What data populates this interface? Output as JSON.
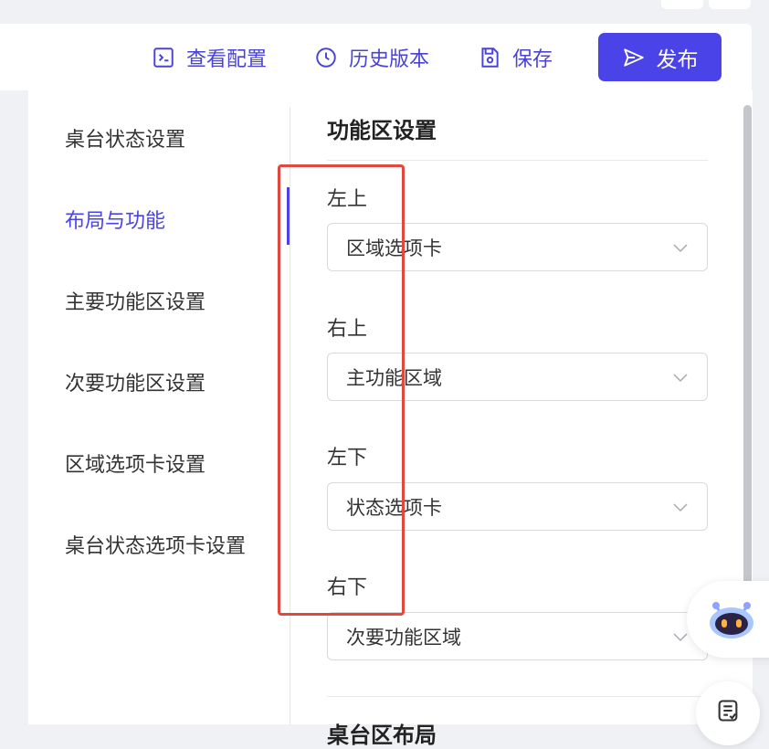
{
  "toolbar": {
    "view_config": "查看配置",
    "history": "历史版本",
    "save": "保存",
    "publish": "发布"
  },
  "nav": {
    "items": [
      {
        "label": "桌台状态设置",
        "active": false
      },
      {
        "label": "布局与功能",
        "active": true
      },
      {
        "label": "主要功能区设置",
        "active": false
      },
      {
        "label": "次要功能区设置",
        "active": false
      },
      {
        "label": "区域选项卡设置",
        "active": false
      },
      {
        "label": "桌台状态选项卡设置",
        "active": false
      }
    ]
  },
  "section": {
    "title": "功能区设置",
    "fields": [
      {
        "label": "左上",
        "value": "区域选项卡"
      },
      {
        "label": "右上",
        "value": "主功能区域"
      },
      {
        "label": "左下",
        "value": "状态选项卡"
      },
      {
        "label": "右下",
        "value": "次要功能区域"
      }
    ],
    "next_title": "桌台区布局"
  },
  "colors": {
    "accent": "#4a43e8",
    "highlight_border": "#e2483e"
  },
  "icons": {
    "view_config": "terminal-icon",
    "history": "clock-icon",
    "save": "save-icon",
    "publish": "send-icon",
    "select": "chevron-down-icon",
    "assistant": "robot-assistant-icon",
    "notes": "notes-icon"
  }
}
